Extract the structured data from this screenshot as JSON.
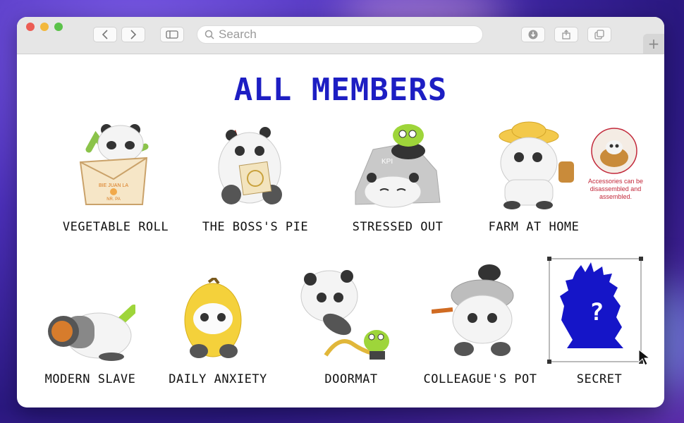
{
  "browser": {
    "search_placeholder": "Search",
    "new_tab_symbol": "+"
  },
  "page": {
    "title": "ALL MEMBERS",
    "accessory_note": "Accessories can be disassembled and assembled."
  },
  "members": [
    {
      "name": "VEGETABLE ROLL"
    },
    {
      "name": "THE BOSS'S PIE"
    },
    {
      "name": "STRESSED OUT"
    },
    {
      "name": "FARM AT HOME"
    },
    {
      "name": "MODERN SLAVE"
    },
    {
      "name": "DAILY ANXIETY"
    },
    {
      "name": "DOORMAT"
    },
    {
      "name": "COLLEAGUE'S POT"
    },
    {
      "name": "SECRET"
    }
  ],
  "box_texts": {
    "roll_brand_1": "BIE JUAN LA",
    "roll_brand_2": "NR. PA",
    "rock_text": "KPI"
  },
  "secret_symbol": "?",
  "colors": {
    "title_blue": "#1d1ec3",
    "secret_blue": "#1515c8",
    "accent_red": "#c2283a"
  }
}
